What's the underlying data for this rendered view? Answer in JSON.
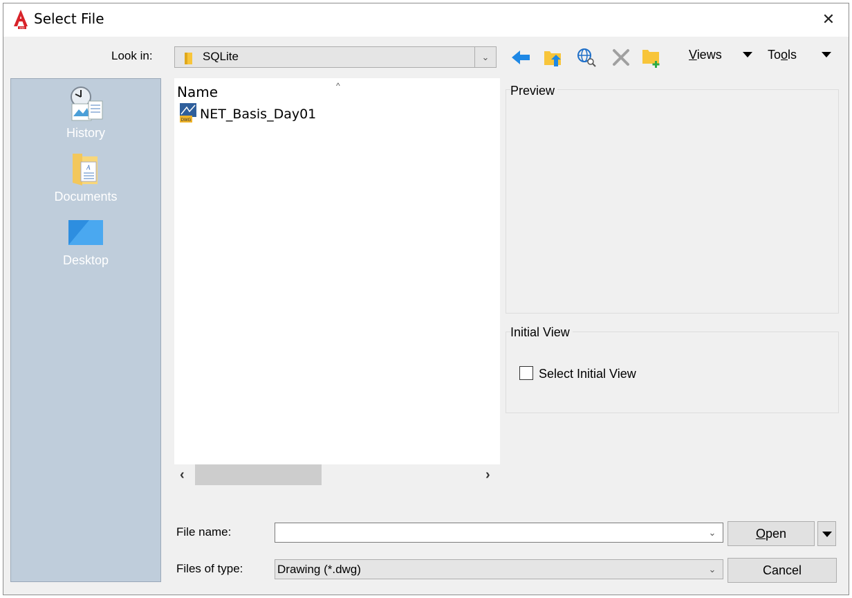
{
  "window": {
    "title": "Select File",
    "close_glyph": "✕"
  },
  "lookin": {
    "label": "Look in:",
    "value": "SQLite"
  },
  "toolbar": {
    "views_label": "Views",
    "views_mnemonic": "V",
    "views_rest": "iews",
    "tools_label": "Tools",
    "tools_pre": "To",
    "tools_mnemonic": "o",
    "tools_post": "ls"
  },
  "places": [
    {
      "label": "History",
      "icon": "history-icon"
    },
    {
      "label": "Documents",
      "icon": "documents-icon"
    },
    {
      "label": "Desktop",
      "icon": "desktop-icon"
    }
  ],
  "filelist": {
    "column_name": "Name",
    "sort_glyph": "^",
    "files": [
      {
        "name": "NET_Basis_Day01",
        "icon": "dwg-file-icon"
      }
    ]
  },
  "preview": {
    "label": "Preview"
  },
  "initial_view": {
    "label": "Initial View",
    "checkbox_label": "Select Initial View",
    "checked": false
  },
  "filename": {
    "label": "File name:",
    "value": ""
  },
  "filetype": {
    "label": "Files of type:",
    "value": "Drawing (*.dwg)"
  },
  "buttons": {
    "open_label": "Open",
    "open_mnemonic": "O",
    "open_rest": "pen",
    "cancel_label": "Cancel"
  },
  "colors": {
    "places_bg": "#bfcddb",
    "accent_blue": "#1e88e5",
    "folder_yellow": "#f8c53a",
    "autocad_red": "#d8232a"
  }
}
